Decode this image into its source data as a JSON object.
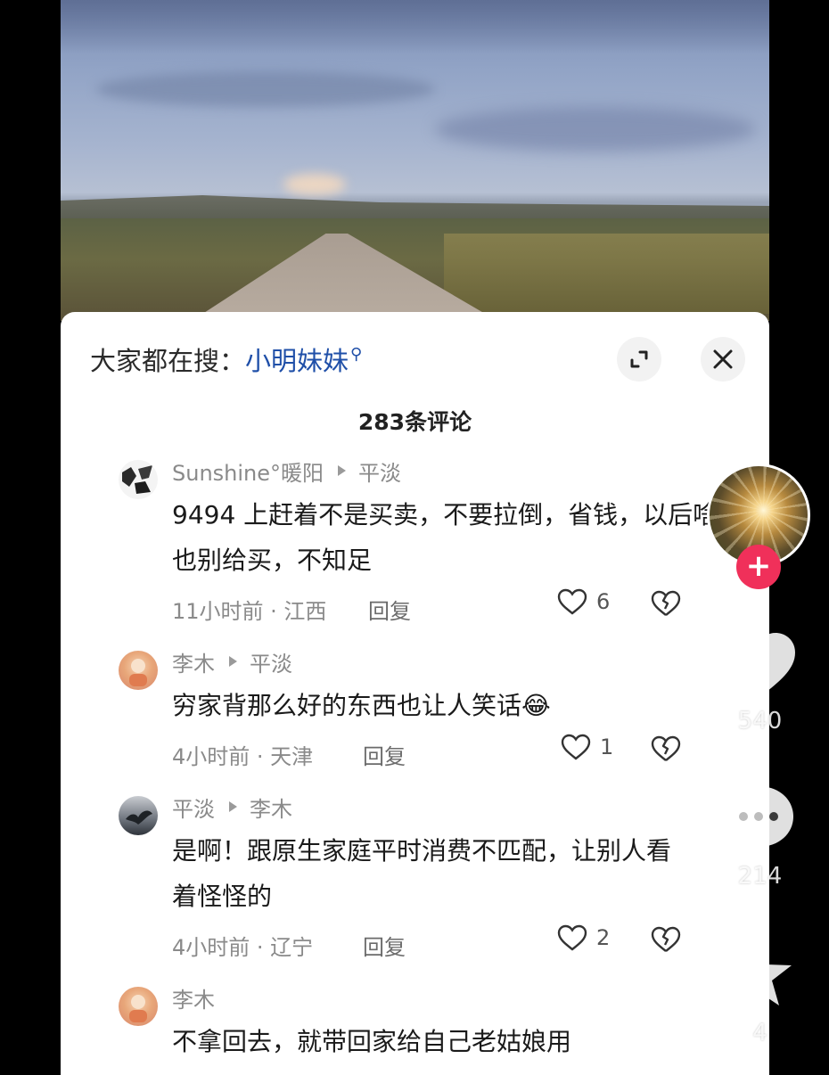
{
  "search_hint": {
    "prefix": "大家都在搜：",
    "keyword": "小明妹妹"
  },
  "comments_header": {
    "count": "283",
    "suffix": "条评论"
  },
  "comments": [
    {
      "author": "Sunshine°暖阳",
      "reply_to": "平淡",
      "text": "9494  上赶着不是买卖，不要拉倒，省钱，以后啥也别给买，不知足",
      "time_location": "11小时前 · 江西",
      "reply_label": "回复",
      "likes": "6"
    },
    {
      "author": "李木",
      "reply_to": "平淡",
      "text": "穷家背那么好的东西也让人笑话",
      "emoji": "😂",
      "time_location": "4小时前 · 天津",
      "reply_label": "回复",
      "likes": "1"
    },
    {
      "author": "平淡",
      "reply_to": "李木",
      "text": "是啊！跟原生家庭平时消费不匹配，让别人看着怪怪的",
      "time_location": "4小时前 · 辽宁",
      "reply_label": "回复",
      "likes": "2"
    },
    {
      "author": "李木",
      "reply_to": "",
      "text": "不拿回去，就带回家给自己老姑娘用",
      "time_location": "",
      "reply_label": "",
      "likes": ""
    }
  ],
  "side_actions": {
    "follow_icon": "plus-icon",
    "like_count": "540",
    "comment_count": "214",
    "favorite_count": "4"
  },
  "colors": {
    "keyword": "#1f4fa8",
    "follow": "#f0305a",
    "panel": "#ffffff"
  }
}
